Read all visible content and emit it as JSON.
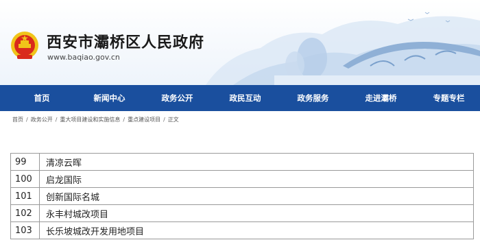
{
  "site": {
    "name": "西安市灞桥区人民政府",
    "url": "www.baqiao.gov.cn",
    "emblem_icon": "national-emblem-icon"
  },
  "colors": {
    "nav_bg": "#1a4f9e",
    "nav_text": "#ffffff",
    "emblem_red": "#d92a1c",
    "emblem_gold": "#f0c419",
    "scenery_blue": "#a9c6e6"
  },
  "nav": {
    "items": [
      {
        "label": "首页"
      },
      {
        "label": "新闻中心"
      },
      {
        "label": "政务公开"
      },
      {
        "label": "政民互动"
      },
      {
        "label": "政务服务"
      },
      {
        "label": "走进灞桥"
      },
      {
        "label": "专题专栏"
      }
    ]
  },
  "breadcrumb": {
    "items": [
      {
        "label": "首页"
      },
      {
        "label": "政务公开"
      },
      {
        "label": "重大项目建设和实施信息"
      },
      {
        "label": "重点建设项目"
      },
      {
        "label": "正文"
      }
    ],
    "separator": "/"
  },
  "table": {
    "rows": [
      {
        "num": "99",
        "name": "清凉云晖"
      },
      {
        "num": "100",
        "name": "启龙国际"
      },
      {
        "num": "101",
        "name": "创新国际名城"
      },
      {
        "num": "102",
        "name": "永丰村城改项目"
      },
      {
        "num": "103",
        "name": "长乐坡城改开发用地项目"
      }
    ]
  }
}
